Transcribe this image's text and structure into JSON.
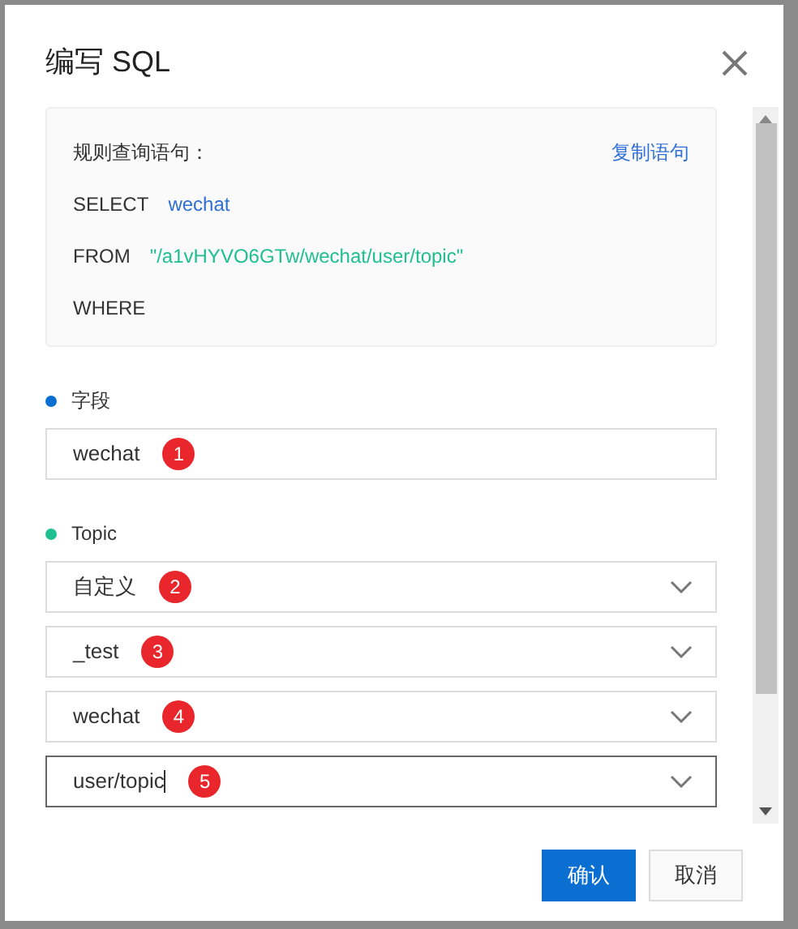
{
  "dialog": {
    "title": "编写 SQL"
  },
  "query_box": {
    "label": "规则查询语句：",
    "copy_link": "复制语句",
    "lines": [
      {
        "keyword": "SELECT",
        "value": "wechat",
        "color": "#2f6fd6"
      },
      {
        "keyword": "FROM",
        "value": "\"/a1vHYVO6GTw/wechat/user/topic\"",
        "color": "#1fbf8f"
      },
      {
        "keyword": "WHERE"
      }
    ]
  },
  "sections": [
    {
      "label": "字段",
      "color": "#0b6fd1",
      "inputs": [
        {
          "kind": "text",
          "value": "wechat",
          "badge": "1",
          "focused": false
        }
      ]
    },
    {
      "label": "Topic",
      "color": "#1fbf8f",
      "inputs": [
        {
          "kind": "select",
          "value": "自定义",
          "badge": "2",
          "focused": false
        },
        {
          "kind": "select",
          "value": "_test",
          "badge": "3",
          "focused": false
        },
        {
          "kind": "select",
          "value": "wechat",
          "badge": "4",
          "focused": false
        },
        {
          "kind": "select",
          "value": "user/topic",
          "badge": "5",
          "focused": true
        }
      ]
    }
  ],
  "buttons": [
    {
      "label": "确认",
      "primary": true
    },
    {
      "label": "取消",
      "primary": false
    }
  ]
}
